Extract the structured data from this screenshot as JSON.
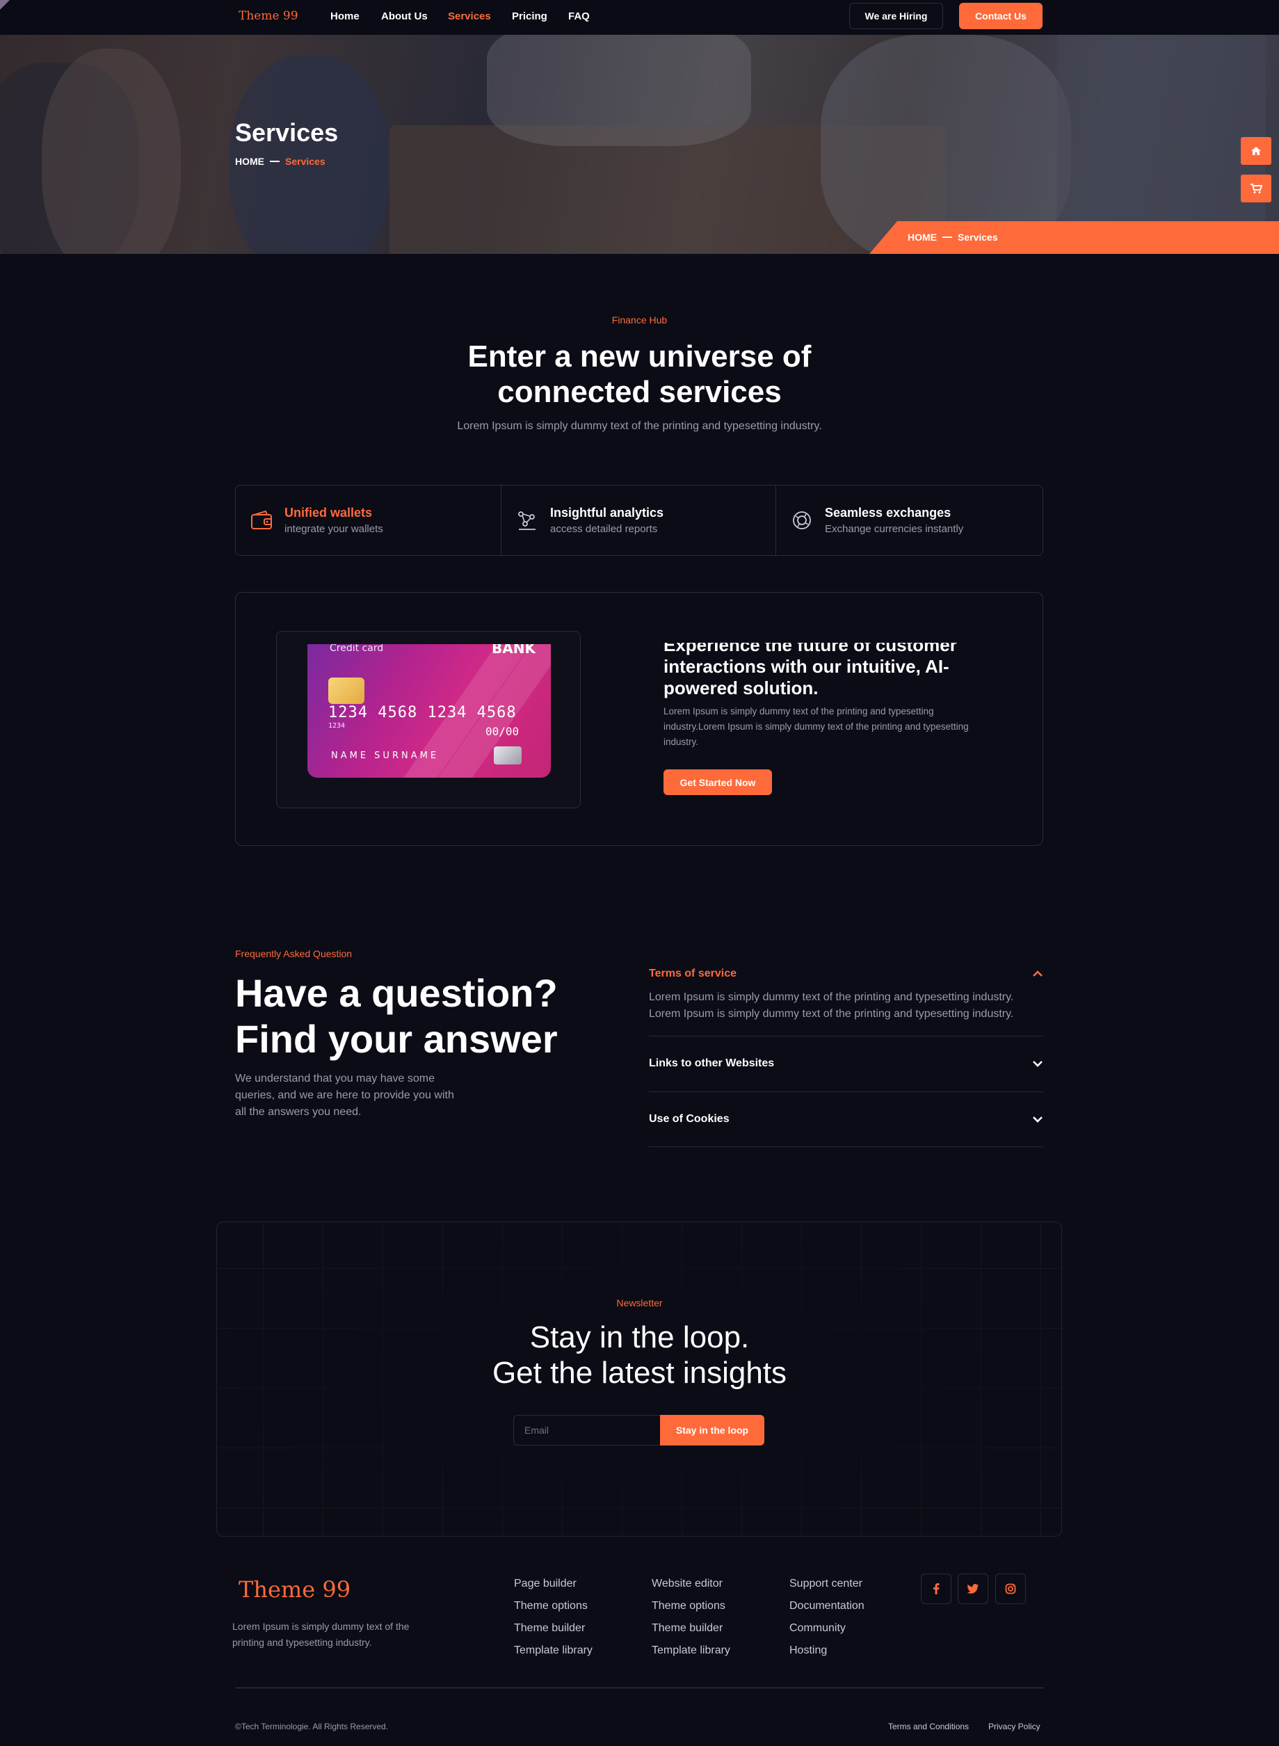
{
  "nav": {
    "logo": "Theme 99",
    "links": [
      "Home",
      "About Us",
      "Services",
      "Pricing",
      "FAQ"
    ],
    "active": "Services",
    "hiring_button": "We are Hiring",
    "contact_button": "Contact Us"
  },
  "hero": {
    "title": "Services",
    "crumb_home": "HOME",
    "crumb_current": "Services",
    "band_home": "HOME",
    "band_current": "Services",
    "side_buttons": [
      "home-icon",
      "cart-icon"
    ]
  },
  "intro": {
    "eyebrow": "Finance Hub",
    "title_line1": "Enter a new universe of",
    "title_line2": "connected services",
    "subtitle": "Lorem Ipsum is simply dummy text of the printing and typesetting industry."
  },
  "features": [
    {
      "title": "Unified wallets",
      "subtitle": "integrate your wallets",
      "icon": "wallet-icon"
    },
    {
      "title": "Insightful analytics",
      "subtitle": "access detailed reports",
      "icon": "analytics-icon"
    },
    {
      "title": "Seamless exchanges",
      "subtitle": "Exchange currencies instantly",
      "icon": "exchange-icon"
    }
  ],
  "card": {
    "label": "Credit card",
    "bank": "BANK",
    "number": "1234 4568 1234 4568",
    "number_small": "1234",
    "expiry": "00/00",
    "name": "NAME SURNAME"
  },
  "promo": {
    "title": "Experience the future of customer interactions with our intuitive, AI-powered solution.",
    "text": "Lorem Ipsum is simply dummy text of the printing and typesetting industry.Lorem Ipsum is simply dummy text of the printing and typesetting industry.",
    "button": "Get Started Now"
  },
  "faq": {
    "eyebrow": "Frequently Asked Question",
    "title_line1": "Have a question?",
    "title_line2": "Find your answer",
    "subtitle": "We understand that you may have some queries, and we are here to provide you with all the answers you need.",
    "items": [
      {
        "question": "Terms of service",
        "answer": "Lorem Ipsum is simply dummy text of the printing and typesetting industry. Lorem Ipsum is simply dummy text of the printing and typesetting industry.",
        "open": true
      },
      {
        "question": "Links to other Websites",
        "open": false
      },
      {
        "question": "Use of Cookies",
        "open": false
      }
    ]
  },
  "newsletter": {
    "eyebrow": "Newsletter",
    "title_line1": "Stay in the loop.",
    "title_line2": "Get the latest insights",
    "email_placeholder": "Email",
    "button": "Stay in the loop"
  },
  "footer": {
    "logo": "Theme 99",
    "description": "Lorem Ipsum is simply dummy text of the printing and typesetting industry.",
    "col1": [
      "Page builder",
      "Theme options",
      "Theme builder",
      "Template library"
    ],
    "col2": [
      "Website editor",
      "Theme options",
      "Theme builder",
      "Template library"
    ],
    "col3": [
      "Support center",
      "Documentation",
      "Community",
      "Hosting"
    ],
    "social": [
      "facebook-icon",
      "twitter-icon",
      "instagram-icon"
    ],
    "copyright": "©Tech Terminologie. All Rights Reserved.",
    "terms": "Terms and Conditions",
    "privacy": "Privacy Policy"
  },
  "colors": {
    "accent": "#ff6a3a",
    "background": "#0b0c15",
    "muted_text": "#9a9cab"
  }
}
